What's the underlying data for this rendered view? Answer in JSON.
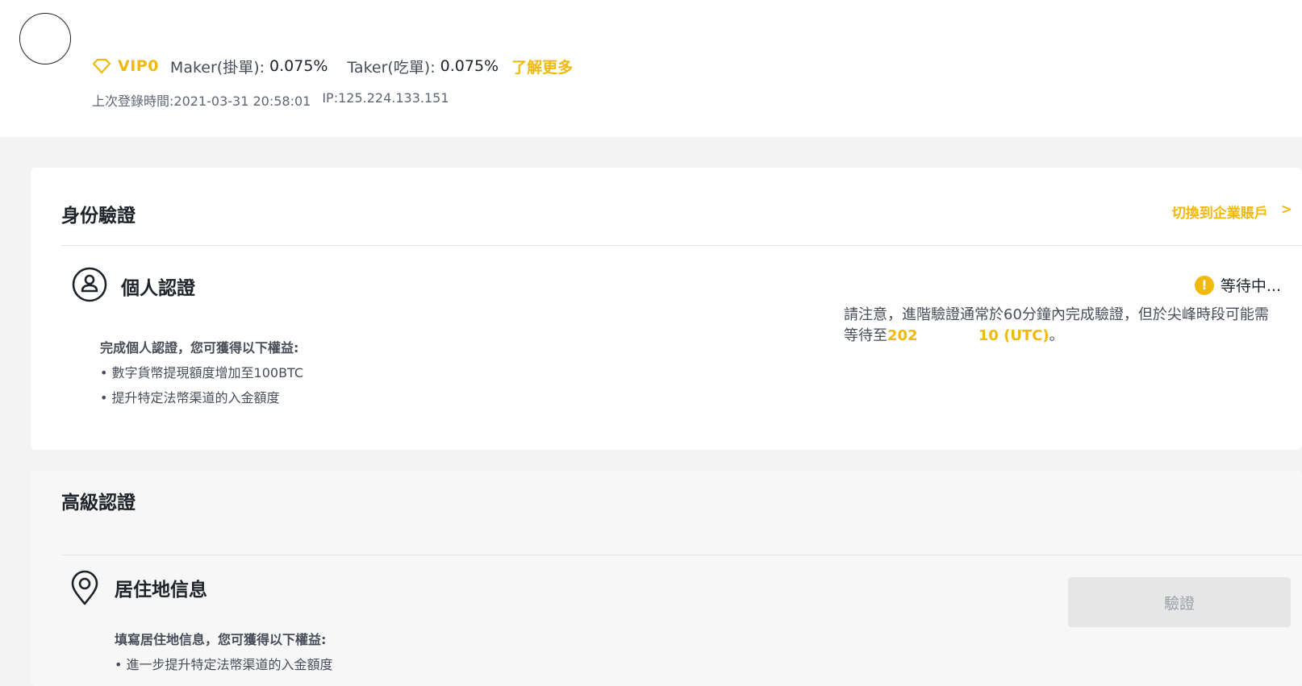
{
  "header": {
    "vip_level": "VIP0",
    "maker_label": "Maker(掛單):",
    "maker_value": "0.075%",
    "taker_label": "Taker(吃單):",
    "taker_value": "0.075%",
    "learn_more": "了解更多",
    "last_login": "上次登錄時間:2021-03-31 20:58:01",
    "ip": "IP:125.224.133.151"
  },
  "identity": {
    "title": "身份驗證",
    "switch_link": "切換到企業賬戶",
    "switch_arrow": ">",
    "personal": {
      "title": "個人認證",
      "status": "等待中...",
      "notice_text": "請注意，進階驗證通常於60分鐘內完成驗證，但於尖峰時段可能需等待至",
      "notice_time": "202            10 (UTC)",
      "notice_end": "。",
      "benefit_head": "完成個人認證，您可獲得以下權益:",
      "benefits": [
        "• 數字貨幣提現額度增加至100BTC",
        "• 提升特定法幣渠道的入金額度"
      ]
    }
  },
  "advanced": {
    "title": "高級認證",
    "residence": {
      "title": "居住地信息",
      "button": "驗證",
      "benefit_head": "填寫居住地信息，您可獲得以下權益:",
      "benefits": [
        "• 進一步提升特定法幣渠道的入金額度"
      ]
    }
  },
  "colors": {
    "accent": "#f0b90b",
    "text": "#1e2329",
    "muted": "#474d57"
  }
}
